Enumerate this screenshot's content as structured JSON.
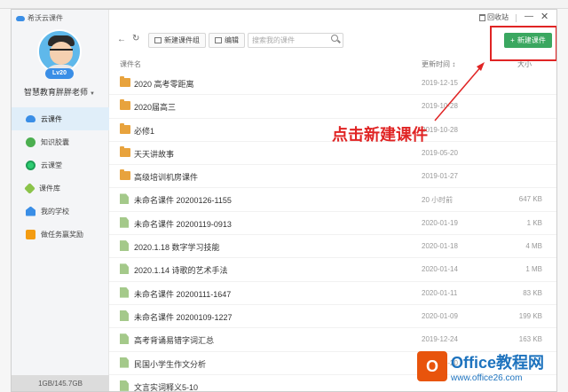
{
  "app": {
    "title": "希沃云课件"
  },
  "user": {
    "name": "智慧教育胖胖老师",
    "level": "Lv20"
  },
  "sidebar": {
    "items": [
      {
        "label": "云课件",
        "icon": "cloud-icon",
        "active": true
      },
      {
        "label": "知识胶囊",
        "icon": "capsule-icon",
        "active": false
      },
      {
        "label": "云课堂",
        "icon": "classroom-icon",
        "active": false
      },
      {
        "label": "课件库",
        "icon": "library-icon",
        "active": false
      },
      {
        "label": "我的学校",
        "icon": "school-icon",
        "active": false
      },
      {
        "label": "做任务赢奖励",
        "icon": "gift-icon",
        "active": false
      }
    ],
    "storage": "1GB/145.7GB"
  },
  "titlebar": {
    "recycle_label": "回收站",
    "min_label": "—",
    "close_label": "✕"
  },
  "toolbar": {
    "back_label": "←",
    "refresh_label": "↻",
    "new_group_label": "新建课件组",
    "edit_label": "编辑",
    "search_placeholder": "搜索我的课件",
    "new_courseware_label": "新建课件"
  },
  "table": {
    "headers": {
      "name": "课件名",
      "date": "更新时间 ↕",
      "size": "大小"
    },
    "rows": [
      {
        "type": "folder",
        "name": "2020 高考零距离",
        "date": "2019-12-15",
        "size": ""
      },
      {
        "type": "folder",
        "name": "2020届高三",
        "date": "2019-10-28",
        "size": ""
      },
      {
        "type": "folder",
        "name": "必修1",
        "date": "2019-10-28",
        "size": ""
      },
      {
        "type": "folder",
        "name": "天天讲故事",
        "date": "2019-05-20",
        "size": ""
      },
      {
        "type": "folder",
        "name": "高级培训机房课件",
        "date": "2019-01-27",
        "size": ""
      },
      {
        "type": "file",
        "name": "未命名课件 20200126-1155",
        "date": "20 小时前",
        "size": "647 KB"
      },
      {
        "type": "file",
        "name": "未命名课件 20200119-0913",
        "date": "2020-01-19",
        "size": "1 KB"
      },
      {
        "type": "file",
        "name": "2020.1.18 数字学习技能",
        "date": "2020-01-18",
        "size": "4 MB"
      },
      {
        "type": "file",
        "name": "2020.1.14 诗歌的艺术手法",
        "date": "2020-01-14",
        "size": "1 MB"
      },
      {
        "type": "file",
        "name": "未命名课件 20200111-1647",
        "date": "2020-01-11",
        "size": "83 KB"
      },
      {
        "type": "file",
        "name": "未命名课件 20200109-1227",
        "date": "2020-01-09",
        "size": "199 KB"
      },
      {
        "type": "file",
        "name": "高考背诵易错字词汇总",
        "date": "2019-12-24",
        "size": "163 KB"
      },
      {
        "type": "file",
        "name": "民国小学生作文分析",
        "date": "2019-12-20",
        "size": ""
      },
      {
        "type": "file",
        "name": "文言实词释义5-10",
        "date": "",
        "size": ""
      }
    ]
  },
  "annotation": {
    "text": "点击新建课件"
  },
  "watermark": {
    "logo": "O",
    "title": "Office教程网",
    "url": "www.office26.com"
  },
  "colors": {
    "accent_green": "#3aa760",
    "annotation_red": "#e02424",
    "sidebar_active": "#e0eef9"
  }
}
